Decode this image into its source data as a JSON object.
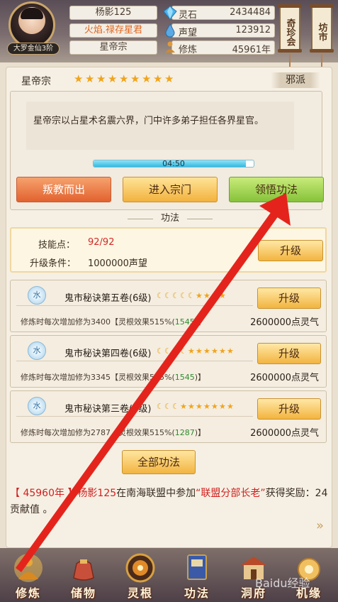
{
  "header": {
    "player_name": "杨影125",
    "player_title": "火焰.禄存星君",
    "sect": "星帝宗",
    "rank": "大罗金仙3阶",
    "resources": [
      {
        "label": "灵石",
        "value": "2434484",
        "icon": "diamond-icon",
        "color": "#3aa3e0"
      },
      {
        "label": "声望",
        "value": "123912",
        "icon": "drop-icon",
        "color": "#4a9ad8"
      },
      {
        "label": "修炼",
        "value": "45961年",
        "icon": "meditation-icon",
        "color": "#d08a30"
      }
    ],
    "shop_button": "奇珍会",
    "market_button": "坊市"
  },
  "sect_info": {
    "name": "星帝宗",
    "stars": 9,
    "alignment": "邪派",
    "description": "星帝宗以占星术名震六界，门中许多弟子担任各界星官。",
    "timer": "04:50",
    "timer_progress": 0.95
  },
  "actions": {
    "betray": "叛教而出",
    "enter": "进入宗门",
    "comprehend": "领悟功法"
  },
  "section_title": "功法",
  "skills": {
    "points_label": "技能点：",
    "points_value": "92/92",
    "condition_label": "升级条件：",
    "condition_value": "1000000声望",
    "upgrade_label": "升级"
  },
  "techniques": [
    {
      "element": "水",
      "name": "鬼市秘诀第五卷(6级)",
      "moons": 5,
      "stars": 4,
      "desc_prefix": "修炼时每次增加修为3400【灵根效果515%(",
      "desc_green": "1545",
      "desc_suffix": ")】",
      "cost": "2600000点灵气",
      "upgrade": "升级"
    },
    {
      "element": "水",
      "name": "鬼市秘诀第四卷(6级)",
      "moons": 4,
      "stars": 6,
      "desc_prefix": "修炼时每次增加修为3345【灵根效果515%(",
      "desc_green": "1545",
      "desc_suffix": ")】",
      "cost": "2600000点灵气",
      "upgrade": "升级"
    },
    {
      "element": "水",
      "name": "鬼市秘诀第三卷(6级)",
      "moons": 3,
      "stars": 7,
      "desc_prefix": "修炼时每次增加修为2787【灵根效果515%(",
      "desc_green": "1287",
      "desc_suffix": ")】",
      "cost": "2600000点灵气",
      "upgrade": "升级"
    }
  ],
  "all_techniques": "全部功法",
  "news": {
    "year": "【 45960年 】",
    "player": "杨影125",
    "mid": "在南海联盟中参加",
    "event": "“联盟分部长老”",
    "reward": "获得奖励：24贡献值 。"
  },
  "bottom_nav": [
    {
      "label": "修炼",
      "icon": "cultivate-icon"
    },
    {
      "label": "储物",
      "icon": "bag-icon"
    },
    {
      "label": "灵根",
      "icon": "spirit-root-icon"
    },
    {
      "label": "功法",
      "icon": "book-icon"
    },
    {
      "label": "洞府",
      "icon": "cave-icon"
    },
    {
      "label": "机缘",
      "icon": "fortune-icon"
    }
  ],
  "watermark": "Baidu经验",
  "colors": {
    "accent_red": "#e4241c",
    "gold": "#f2b440",
    "green": "#86c23a"
  }
}
